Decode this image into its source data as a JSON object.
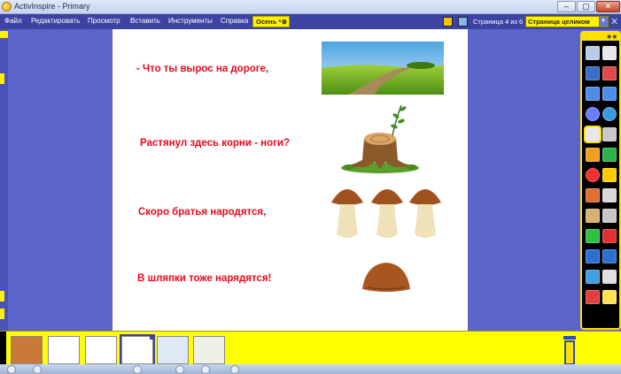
{
  "window": {
    "title": "ActivInspire - Primary"
  },
  "menu": {
    "items": [
      "Файл",
      "Редактировать",
      "Просмотр",
      "Вставить",
      "Инструменты",
      "Справка"
    ],
    "active_tab": "Осень *"
  },
  "pager": {
    "page_count": "Страница 4 из 6",
    "zoom_value": "Страница целиком"
  },
  "page": {
    "lines": [
      "- Что ты вырос на дороге,",
      "Растянул здесь корни - ноги?",
      "Скоро братья народятся,",
      "В шляпки тоже нарядятся!"
    ]
  },
  "colors": {
    "verse_text": "#e8091b",
    "toolbox_accent": "#ffe000",
    "tray": "#ffff00",
    "menubar": "#3c43a2"
  },
  "icons": {
    "field_image": "meadow-road-picture",
    "stump_image": "tree-stump-picture",
    "mushrooms_image": "three-mushrooms-picture",
    "cap_image": "mushroom-cap-picture"
  }
}
